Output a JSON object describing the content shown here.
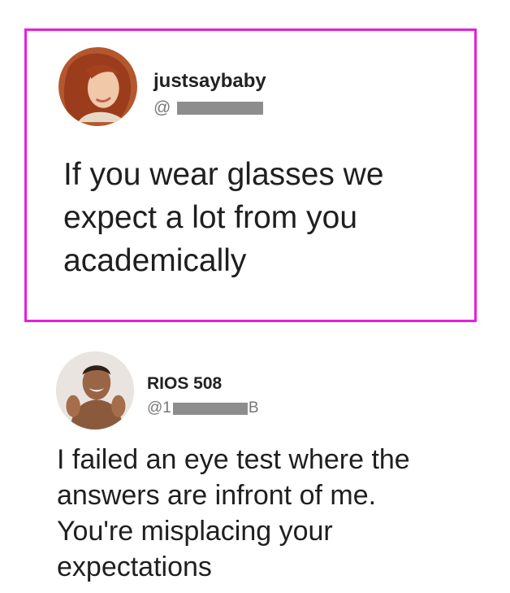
{
  "tweets": [
    {
      "username": "justsaybaby",
      "handle_prefix": "@",
      "handle_suffix": "",
      "text_lines": [
        "If you wear glasses we",
        "expect a lot from you",
        "academically"
      ],
      "avatar_icon": "profile-photo-woman"
    },
    {
      "username": "RIOS 508",
      "handle_prefix": "@1",
      "handle_suffix": "B",
      "text_lines": [
        "I failed an eye test where the",
        "answers are infront of me.",
        "You're misplacing your",
        "expectations"
      ],
      "avatar_icon": "profile-photo-man"
    }
  ],
  "colors": {
    "highlight_border": "#e61ee0",
    "redaction": "#8d8d8d"
  }
}
